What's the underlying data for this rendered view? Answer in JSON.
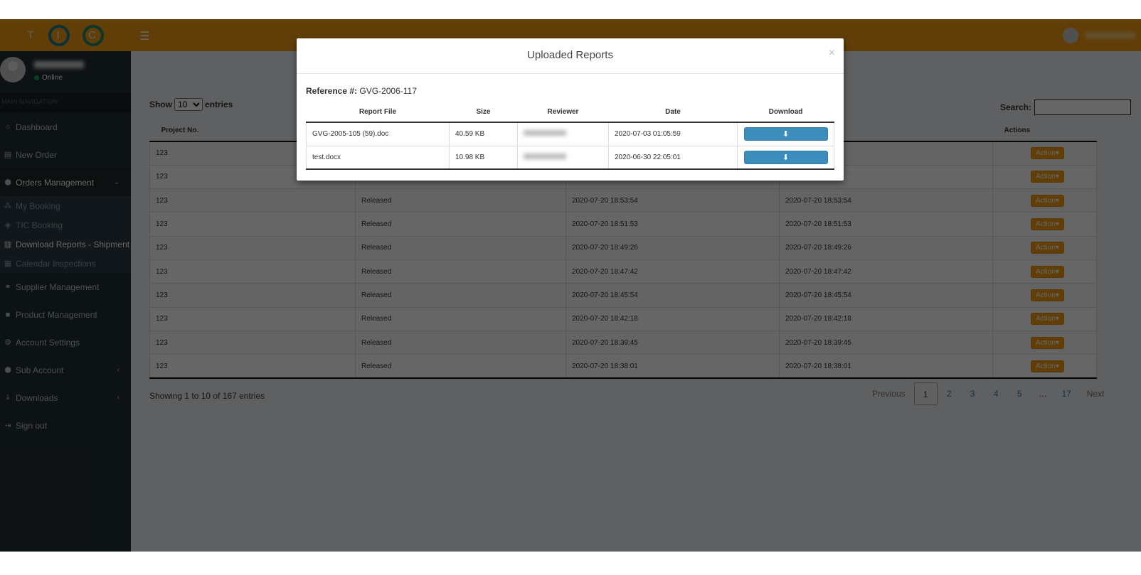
{
  "topbar": {
    "logo_letters": [
      "T",
      "I",
      "C"
    ],
    "menu_icon": "hamburger-icon",
    "user_avatar_icon": "user-avatar-icon"
  },
  "sidebar": {
    "user_status": "Online",
    "nav_header": "MAIN NAVIGATION",
    "items": [
      {
        "label": "Dashboard",
        "icon": "circle-icon"
      },
      {
        "label": "New Order",
        "icon": "file-icon"
      },
      {
        "label": "Orders Management",
        "icon": "cube-icon",
        "expanded": true,
        "children": [
          {
            "label": "My Booking",
            "icon": "cubes-icon"
          },
          {
            "label": "TIC Booking",
            "icon": "box-icon"
          },
          {
            "label": "Download Reports - Shipment",
            "icon": "word-file-icon",
            "active": true
          },
          {
            "label": "Calendar Inspections",
            "icon": "calendar-icon"
          }
        ]
      },
      {
        "label": "Supplier Management",
        "icon": "handshake-icon"
      },
      {
        "label": "Product Management",
        "icon": "folder-icon"
      },
      {
        "label": "Account Settings",
        "icon": "gear-icon"
      },
      {
        "label": "Sub Account",
        "icon": "cube-icon",
        "chevron": "left"
      },
      {
        "label": "Downloads",
        "icon": "download-icon",
        "chevron": "left"
      },
      {
        "label": "Sign out",
        "icon": "sign-out-icon"
      }
    ]
  },
  "list": {
    "show_label": "Show",
    "entries_label": "entries",
    "page_length": "10",
    "search_label": "Search:",
    "search_value": "",
    "columns": [
      "Project No.",
      "",
      "",
      "",
      "Actions"
    ],
    "action_label": "Action",
    "rows": [
      {
        "project": "123",
        "status": "",
        "date1": "",
        "date2": ""
      },
      {
        "project": "123",
        "status": "",
        "date1": "",
        "date2": ""
      },
      {
        "project": "123",
        "status": "Released",
        "date1": "2020-07-20 18:53:54",
        "date2": "2020-07-20 18:53:54"
      },
      {
        "project": "123",
        "status": "Released",
        "date1": "2020-07-20 18:51:53",
        "date2": "2020-07-20 18:51:53"
      },
      {
        "project": "123",
        "status": "Released",
        "date1": "2020-07-20 18:49:26",
        "date2": "2020-07-20 18:49:26"
      },
      {
        "project": "123",
        "status": "Released",
        "date1": "2020-07-20 18:47:42",
        "date2": "2020-07-20 18:47:42"
      },
      {
        "project": "123",
        "status": "Released",
        "date1": "2020-07-20 18:45:54",
        "date2": "2020-07-20 18:45:54"
      },
      {
        "project": "123",
        "status": "Released",
        "date1": "2020-07-20 18:42:18",
        "date2": "2020-07-20 18:42:18"
      },
      {
        "project": "123",
        "status": "Released",
        "date1": "2020-07-20 18:39:45",
        "date2": "2020-07-20 18:39:45"
      },
      {
        "project": "123",
        "status": "Released",
        "date1": "2020-07-20 18:38:01",
        "date2": "2020-07-20 18:38:01"
      }
    ],
    "info": "Showing 1 to 10 of 167 entries",
    "pagination": {
      "previous": "Previous",
      "pages": [
        "1",
        "2",
        "3",
        "4",
        "5",
        "…",
        "17"
      ],
      "active": "1",
      "next": "Next"
    }
  },
  "modal": {
    "title": "Uploaded Reports",
    "close": "×",
    "reference_label": "Reference #:",
    "reference_value": "GVG-2006-117",
    "columns": [
      "Report File",
      "Size",
      "Reviewer",
      "Date",
      "Download"
    ],
    "rows": [
      {
        "file": "GVG-2005-105 (59).doc",
        "size": "40.59 KB",
        "date": "2020-07-03 01:05:59"
      },
      {
        "file": "test.docx",
        "size": "10.98 KB",
        "date": "2020-06-30 22:05:01"
      }
    ],
    "download_icon": "⬇"
  },
  "colors": {
    "topbar": "#f39c12",
    "sidebar": "#222d32",
    "action_button": "#f39c12",
    "download_button": "#3c8dbc"
  }
}
